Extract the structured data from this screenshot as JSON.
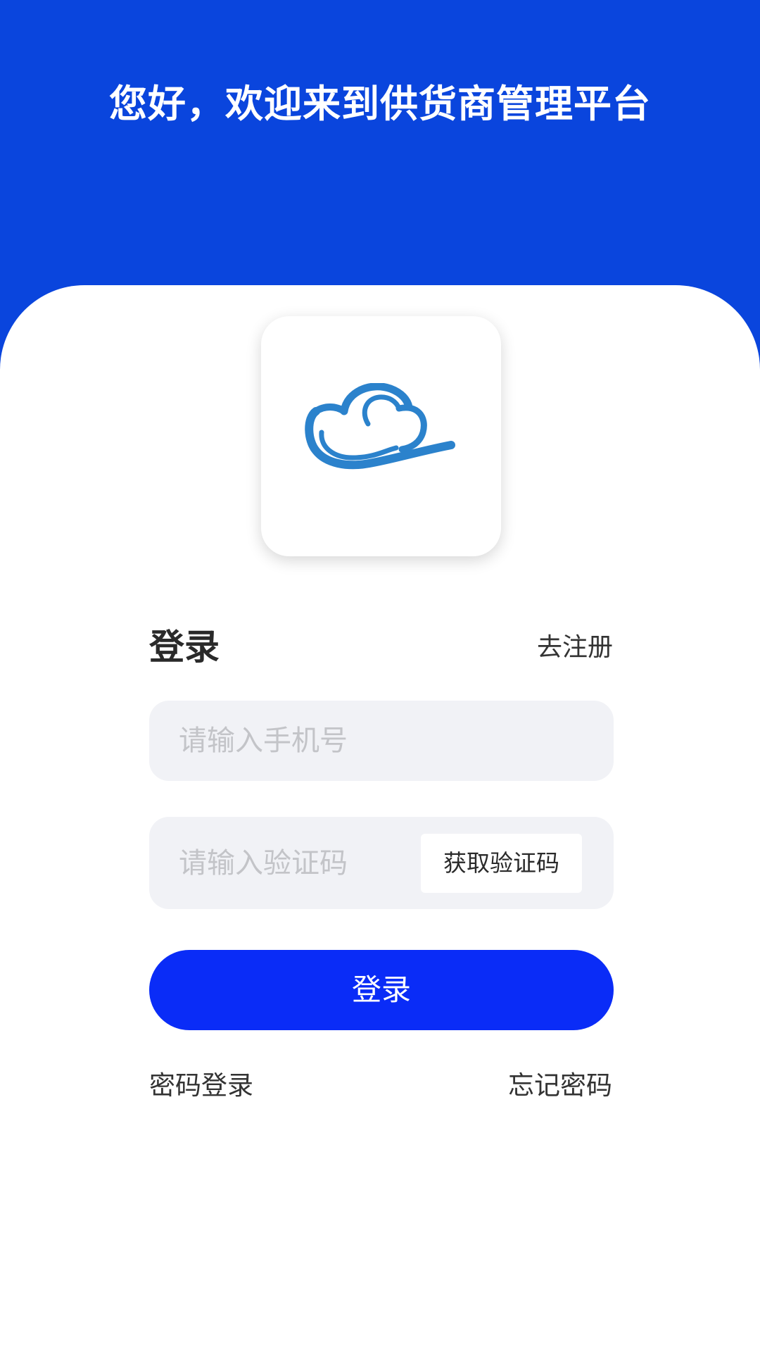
{
  "header": {
    "welcome_text": "您好，欢迎来到供货商管理平台"
  },
  "logo": {
    "icon": "cloud-logo-icon",
    "color": "#2b82cc"
  },
  "colors": {
    "header_bg": "#0a45dd",
    "primary_button": "#0a2cf7",
    "field_bg": "#f1f2f6"
  },
  "form": {
    "title": "登录",
    "register_link": "去注册",
    "phone_placeholder": "请输入手机号",
    "code_placeholder": "请输入验证码",
    "get_code_label": "获取验证码",
    "submit_label": "登录"
  },
  "footer_links": {
    "password_login": "密码登录",
    "forgot_password": "忘记密码"
  }
}
